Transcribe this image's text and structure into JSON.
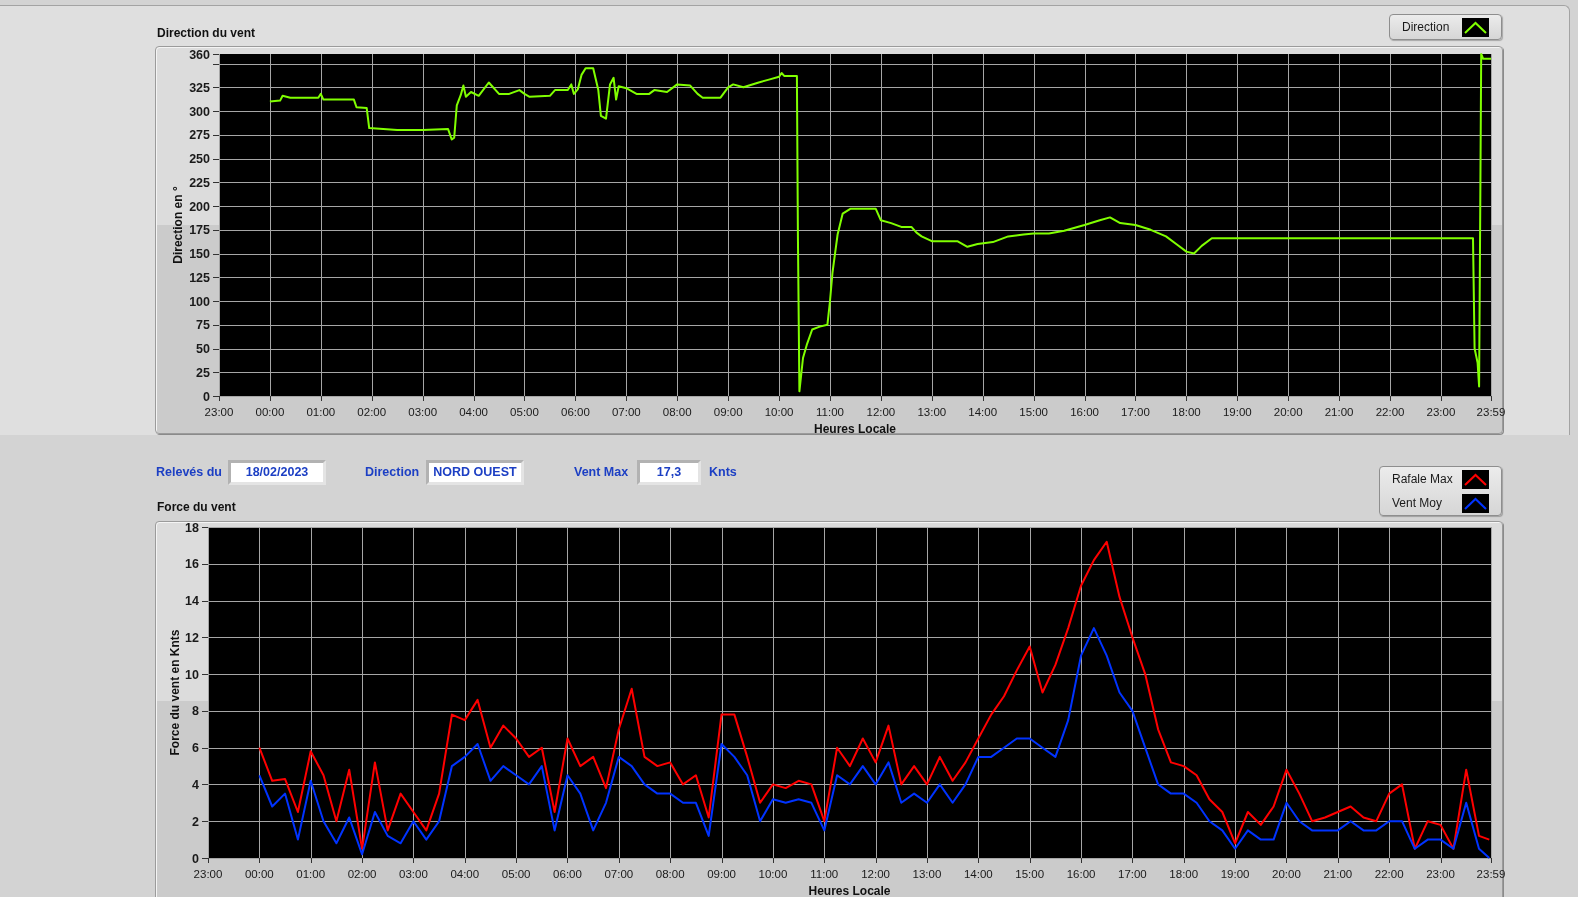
{
  "direction_chart": {
    "x_axis_start_label": "23:00",
    "chart_data": {
      "type": "line",
      "title": "Direction du vent",
      "xlabel": "Heures Locale",
      "ylabel": "Direction en °",
      "grid": true,
      "x": [
        0,
        0.2,
        0.25,
        0.4,
        0.95,
        1,
        1.05,
        1.65,
        1.7,
        1.9,
        1.95,
        2.5,
        3,
        3.5,
        3.57,
        3.62,
        3.67,
        3.75,
        3.8,
        3.85,
        3.95,
        4.1,
        4.3,
        4.5,
        4.7,
        4.9,
        5,
        5.1,
        5.5,
        5.6,
        5.85,
        5.92,
        5.97,
        6.05,
        6.12,
        6.2,
        6.35,
        6.45,
        6.5,
        6.6,
        6.68,
        6.75,
        6.8,
        6.85,
        7,
        7.2,
        7.45,
        7.55,
        7.8,
        8,
        8.25,
        8.4,
        8.5,
        8.85,
        9,
        9.1,
        9.3,
        9.6,
        9.8,
        10,
        10.05,
        10.1,
        10.35,
        10.37,
        10.4,
        10.47,
        10.55,
        10.65,
        10.8,
        10.95,
        11,
        11.05,
        11.15,
        11.25,
        11.4,
        11.9,
        12,
        12.2,
        12.4,
        12.6,
        12.7,
        12.8,
        13,
        13.5,
        13.7,
        13.9,
        14.2,
        14.5,
        14.8,
        15,
        15.3,
        15.6,
        16,
        16.3,
        16.5,
        16.7,
        17,
        17.3,
        17.6,
        17.8,
        18,
        18.15,
        18.3,
        18.5,
        23.63,
        23.66,
        23.72,
        23.75,
        23.77,
        23.79,
        23.83,
        23.983
      ],
      "series": [
        {
          "name": "Direction",
          "color": "#80ff00",
          "values": [
            310,
            311,
            316,
            314,
            314,
            318,
            312,
            312,
            304,
            303,
            282,
            280,
            280,
            281,
            270,
            272,
            306,
            317,
            327,
            315,
            320,
            316,
            330,
            318,
            318,
            322,
            318,
            315,
            316,
            322,
            322,
            328,
            318,
            323,
            338,
            345,
            345,
            322,
            295,
            292,
            328,
            335,
            312,
            326,
            324,
            318,
            318,
            322,
            320,
            328,
            327,
            318,
            314,
            314,
            325,
            328,
            325,
            330,
            333,
            336,
            340,
            337,
            337,
            170,
            5,
            40,
            55,
            70,
            73,
            75,
            100,
            130,
            170,
            192,
            197,
            197,
            185,
            182,
            178,
            178,
            172,
            168,
            163,
            163,
            157,
            160,
            162,
            168,
            170,
            171,
            171,
            174,
            180,
            185,
            188,
            182,
            180,
            175,
            168,
            160,
            152,
            150,
            158,
            166,
            166,
            50,
            35,
            10,
            190,
            360,
            355,
            355
          ]
        }
      ],
      "xlim": [
        -1,
        23.983
      ],
      "ylim": [
        0,
        360
      ],
      "xticks": [
        {
          "value": 0,
          "label": "00:00"
        },
        {
          "value": 1,
          "label": "01:00"
        },
        {
          "value": 2,
          "label": "02:00"
        },
        {
          "value": 3,
          "label": "03:00"
        },
        {
          "value": 4,
          "label": "04:00"
        },
        {
          "value": 5,
          "label": "05:00"
        },
        {
          "value": 6,
          "label": "06:00"
        },
        {
          "value": 7,
          "label": "07:00"
        },
        {
          "value": 8,
          "label": "08:00"
        },
        {
          "value": 9,
          "label": "09:00"
        },
        {
          "value": 10,
          "label": "10:00"
        },
        {
          "value": 11,
          "label": "11:00"
        },
        {
          "value": 12,
          "label": "12:00"
        },
        {
          "value": 13,
          "label": "13:00"
        },
        {
          "value": 14,
          "label": "14:00"
        },
        {
          "value": 15,
          "label": "15:00"
        },
        {
          "value": 16,
          "label": "16:00"
        },
        {
          "value": 17,
          "label": "17:00"
        },
        {
          "value": 18,
          "label": "18:00"
        },
        {
          "value": 19,
          "label": "19:00"
        },
        {
          "value": 20,
          "label": "20:00"
        },
        {
          "value": 21,
          "label": "21:00"
        },
        {
          "value": 22,
          "label": "22:00"
        },
        {
          "value": 23,
          "label": "23:00"
        },
        {
          "value": 23.983,
          "label": "23:59"
        }
      ],
      "yticks": [
        0,
        25,
        50,
        75,
        100,
        125,
        150,
        175,
        200,
        225,
        250,
        275,
        300,
        325,
        360
      ]
    }
  },
  "readings": [
    {
      "label": "Relevés du",
      "value": "18/02/2023"
    },
    {
      "label": "Direction",
      "value": "NORD OUEST"
    },
    {
      "label": "Vent Max",
      "value": "17,3",
      "unit": "Knts"
    }
  ],
  "force_chart": {
    "x_axis_start_label": "23:00",
    "chart_data": {
      "type": "line",
      "title": "Force du vent",
      "xlabel": "Heures Locale",
      "ylabel": "Force du vent en Knts",
      "grid": true,
      "x": [
        0,
        0.25,
        0.5,
        0.75,
        1,
        1.25,
        1.5,
        1.75,
        2,
        2.25,
        2.5,
        2.75,
        3,
        3.25,
        3.5,
        3.75,
        4,
        4.25,
        4.5,
        4.75,
        5,
        5.25,
        5.5,
        5.75,
        6,
        6.25,
        6.5,
        6.75,
        7,
        7.25,
        7.5,
        7.75,
        8,
        8.25,
        8.5,
        8.75,
        9,
        9.25,
        9.5,
        9.75,
        10,
        10.25,
        10.5,
        10.75,
        11,
        11.25,
        11.5,
        11.75,
        12,
        12.25,
        12.5,
        12.75,
        13,
        13.25,
        13.5,
        13.75,
        14,
        14.25,
        14.5,
        14.75,
        15,
        15.25,
        15.5,
        15.75,
        16,
        16.25,
        16.5,
        16.75,
        17,
        17.25,
        17.5,
        17.75,
        18,
        18.25,
        18.5,
        18.75,
        19,
        19.25,
        19.5,
        19.75,
        20,
        20.25,
        20.5,
        20.75,
        21,
        21.25,
        21.5,
        21.75,
        22,
        22.25,
        22.5,
        22.75,
        23,
        23.25,
        23.5,
        23.75,
        23.95
      ],
      "series": [
        {
          "name": "Rafale Max",
          "color": "#ff0000",
          "values": [
            6,
            4.2,
            4.3,
            2.5,
            5.8,
            4.5,
            2,
            4.8,
            0.5,
            5.2,
            1.5,
            3.5,
            2.5,
            1.5,
            3.5,
            7.8,
            7.5,
            8.6,
            6,
            7.2,
            6.5,
            5.5,
            6,
            2.5,
            6.5,
            5,
            5.5,
            3.8,
            7,
            9.2,
            5.5,
            5,
            5.2,
            4,
            4.5,
            2.2,
            7.8,
            7.8,
            5.5,
            3,
            4,
            3.8,
            4.2,
            4,
            2,
            6,
            5,
            6.5,
            5.2,
            7.2,
            4,
            5,
            4,
            5.5,
            4.2,
            5.2,
            6.5,
            7.8,
            8.8,
            10.2,
            11.5,
            9,
            10.5,
            12.5,
            14.8,
            16.2,
            17.2,
            14.2,
            12,
            10,
            7,
            5.2,
            5,
            4.5,
            3.2,
            2.5,
            0.8,
            2.5,
            1.8,
            2.8,
            4.8,
            3.5,
            2,
            2.2,
            2.5,
            2.8,
            2.2,
            2,
            3.5,
            4,
            0.5,
            2,
            1.8,
            0.5,
            4.8,
            1.2,
            1
          ]
        },
        {
          "name": "Vent Moy",
          "color": "#0033ff",
          "values": [
            4.5,
            2.8,
            3.5,
            1,
            4.2,
            2,
            0.8,
            2.2,
            0.2,
            2.5,
            1.2,
            0.8,
            2,
            1,
            2,
            5,
            5.5,
            6.2,
            4.2,
            5,
            4.5,
            4,
            5,
            1.5,
            4.5,
            3.5,
            1.5,
            3,
            5.5,
            5,
            4,
            3.5,
            3.5,
            3,
            3,
            1.2,
            6.2,
            5.5,
            4.5,
            2,
            3.2,
            3,
            3.2,
            3,
            1.5,
            4.5,
            4,
            5,
            4,
            5.2,
            3,
            3.5,
            3,
            4,
            3,
            4,
            5.5,
            5.5,
            6,
            6.5,
            6.5,
            6,
            5.5,
            7.5,
            11,
            12.5,
            11,
            9,
            8,
            6,
            4,
            3.5,
            3.5,
            3,
            2,
            1.5,
            0.5,
            1.5,
            1,
            1,
            3,
            2,
            1.5,
            1.5,
            1.5,
            2,
            1.5,
            1.5,
            2,
            2,
            0.5,
            1,
            1,
            0.5,
            3,
            0.5,
            0
          ]
        }
      ],
      "xlim": [
        -1,
        23.983
      ],
      "ylim": [
        0,
        18
      ],
      "xticks": [
        {
          "value": 0,
          "label": "00:00"
        },
        {
          "value": 1,
          "label": "01:00"
        },
        {
          "value": 2,
          "label": "02:00"
        },
        {
          "value": 3,
          "label": "03:00"
        },
        {
          "value": 4,
          "label": "04:00"
        },
        {
          "value": 5,
          "label": "05:00"
        },
        {
          "value": 6,
          "label": "06:00"
        },
        {
          "value": 7,
          "label": "07:00"
        },
        {
          "value": 8,
          "label": "08:00"
        },
        {
          "value": 9,
          "label": "09:00"
        },
        {
          "value": 10,
          "label": "10:00"
        },
        {
          "value": 11,
          "label": "11:00"
        },
        {
          "value": 12,
          "label": "12:00"
        },
        {
          "value": 13,
          "label": "13:00"
        },
        {
          "value": 14,
          "label": "14:00"
        },
        {
          "value": 15,
          "label": "15:00"
        },
        {
          "value": 16,
          "label": "16:00"
        },
        {
          "value": 17,
          "label": "17:00"
        },
        {
          "value": 18,
          "label": "18:00"
        },
        {
          "value": 19,
          "label": "19:00"
        },
        {
          "value": 20,
          "label": "20:00"
        },
        {
          "value": 21,
          "label": "21:00"
        },
        {
          "value": 22,
          "label": "22:00"
        },
        {
          "value": 23,
          "label": "23:00"
        },
        {
          "value": 23.983,
          "label": "23:59"
        }
      ],
      "yticks": [
        0,
        2,
        4,
        6,
        8,
        10,
        12,
        14,
        16,
        18
      ]
    }
  }
}
